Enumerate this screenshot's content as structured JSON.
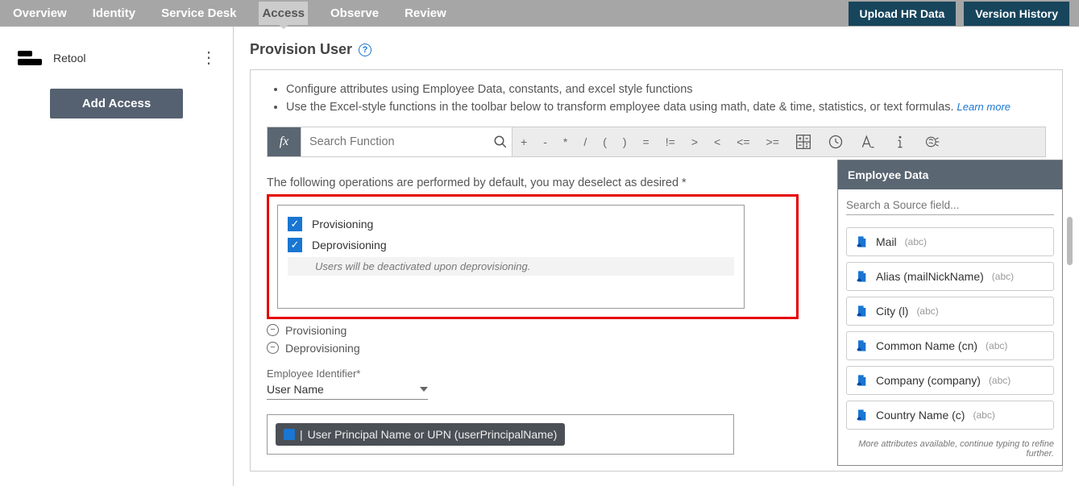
{
  "topbar": {
    "tabs": [
      "Overview",
      "Identity",
      "Service Desk",
      "Access",
      "Observe",
      "Review"
    ],
    "active_index": 3,
    "upload_btn": "Upload HR Data",
    "version_btn": "Version History"
  },
  "sidebar": {
    "app_name": "Retool",
    "add_btn": "Add Access"
  },
  "page": {
    "title": "Provision User",
    "instruction1": "Configure attributes using Employee Data, constants, and excel style functions",
    "instruction2": "Use the Excel-style functions in the toolbar below to transform employee data using math, date & time, statistics, or text formulas.",
    "learn_more": "Learn more",
    "search_fn_placeholder": "Search Function",
    "operators": [
      "+",
      "-",
      "*",
      "/",
      "(",
      ")",
      "=",
      "!=",
      ">",
      "<",
      "<=",
      ">="
    ],
    "ops_note": "The following operations are performed by default, you may deselect as desired *",
    "ops": {
      "provisioning_label": "Provisioning",
      "deprovisioning_label": "Deprovisioning"
    },
    "deact_note": "Users will be deactivated upon deprovisioning.",
    "coll_prov": "Provisioning",
    "coll_deprov": "Deprovisioning",
    "emp_id_label": "Employee Identifier*",
    "emp_id_value": "User Name",
    "upn_chip": "User Principal Name or UPN (userPrincipalName)"
  },
  "emp_panel": {
    "title": "Employee Data",
    "search_placeholder": "Search a Source field...",
    "items": [
      {
        "label": "Mail",
        "type": "(abc)"
      },
      {
        "label": "Alias (mailNickName)",
        "type": "(abc)"
      },
      {
        "label": "City (l)",
        "type": "(abc)"
      },
      {
        "label": "Common Name (cn)",
        "type": "(abc)"
      },
      {
        "label": "Company (company)",
        "type": "(abc)"
      },
      {
        "label": "Country Name (c)",
        "type": "(abc)"
      }
    ],
    "footer": "More attributes available, continue typing to refine further."
  }
}
